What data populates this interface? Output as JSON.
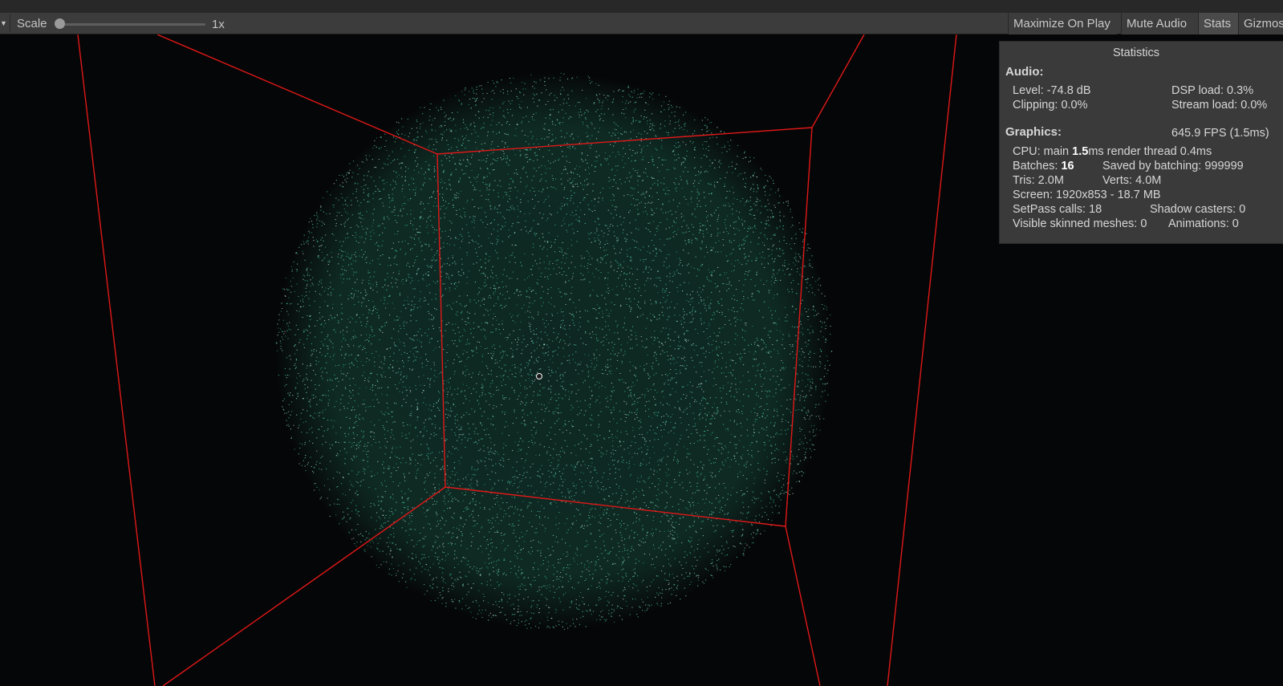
{
  "toolbar": {
    "scale_label": "Scale",
    "scale_value": "1x",
    "maximize_on_play": "Maximize On Play",
    "mute_audio": "Mute Audio",
    "stats": "Stats",
    "gizmos": "Gizmos"
  },
  "stats": {
    "title": "Statistics",
    "audio": {
      "heading": "Audio:",
      "level": "Level: -74.8 dB",
      "clipping": "Clipping: 0.0%",
      "dsp_load": "DSP load: 0.3%",
      "stream_load": "Stream load: 0.0%"
    },
    "graphics": {
      "heading": "Graphics:",
      "fps": "645.9 FPS (1.5ms)",
      "cpu_prefix": "CPU: main ",
      "cpu_main": "1.5",
      "cpu_suffix": "ms  render thread 0.4ms",
      "batches_prefix": "Batches: ",
      "batches": "16",
      "saved_by_batching": "Saved by batching: 999999",
      "tris": "Tris: 2.0M",
      "verts": "Verts: 4.0M",
      "screen": "Screen: 1920x853 - 18.7 MB",
      "setpass": "SetPass calls: 18",
      "shadow_casters": "Shadow casters: 0",
      "visible_skinned": "Visible skinned meshes: 0",
      "animations": "Animations: 0"
    }
  },
  "colors": {
    "particles": "#3fc9a3",
    "bounds_lines": "#e01818",
    "background": "#050607"
  }
}
